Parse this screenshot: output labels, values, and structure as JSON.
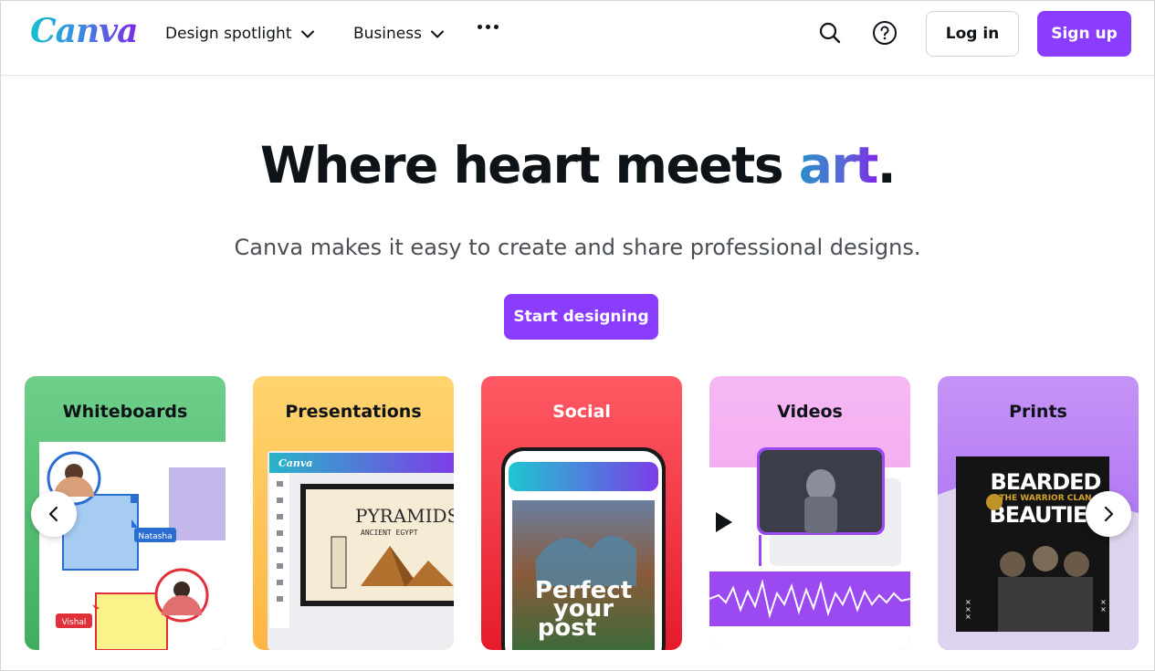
{
  "header": {
    "logo_text": "Canva",
    "nav": [
      {
        "label": "Design spotlight"
      },
      {
        "label": "Business"
      }
    ],
    "login_label": "Log in",
    "signup_label": "Sign up",
    "icons": [
      "search-icon",
      "help-icon",
      "more-icon",
      "chevron-down-icon"
    ]
  },
  "hero": {
    "title_main": "Where heart meets ",
    "title_accent": "art",
    "title_end": ".",
    "subtitle": "Canva makes it easy to create and share professional designs.",
    "cta_label": "Start designing"
  },
  "cards": [
    {
      "title": "Whiteboards",
      "labels": {
        "user1": "Natasha",
        "user2": "Vishal"
      }
    },
    {
      "title": "Presentations",
      "labels": {
        "brand": "Canva",
        "slide_title": "PYRAMIDS",
        "slide_sub": "ANCIENT EGYPT"
      }
    },
    {
      "title": "Social",
      "labels": {
        "post_text_1": "Perfect",
        "post_text_2": "your",
        "post_text_3": "post"
      }
    },
    {
      "title": "Videos"
    },
    {
      "title": "Prints",
      "labels": {
        "poster_1": "BEARDED",
        "poster_2": "BEAUTIES",
        "poster_3": "THE WARRIOR CLAN"
      }
    }
  ],
  "colors": {
    "brand_purple": "#8b3dff",
    "whiteboards_bg": "#5cc27b",
    "presentations_bg": "#ffc857",
    "social_bg": "#f0283c",
    "videos_bg": "#f3a8f0",
    "prints_bg": "#b77cf5"
  }
}
